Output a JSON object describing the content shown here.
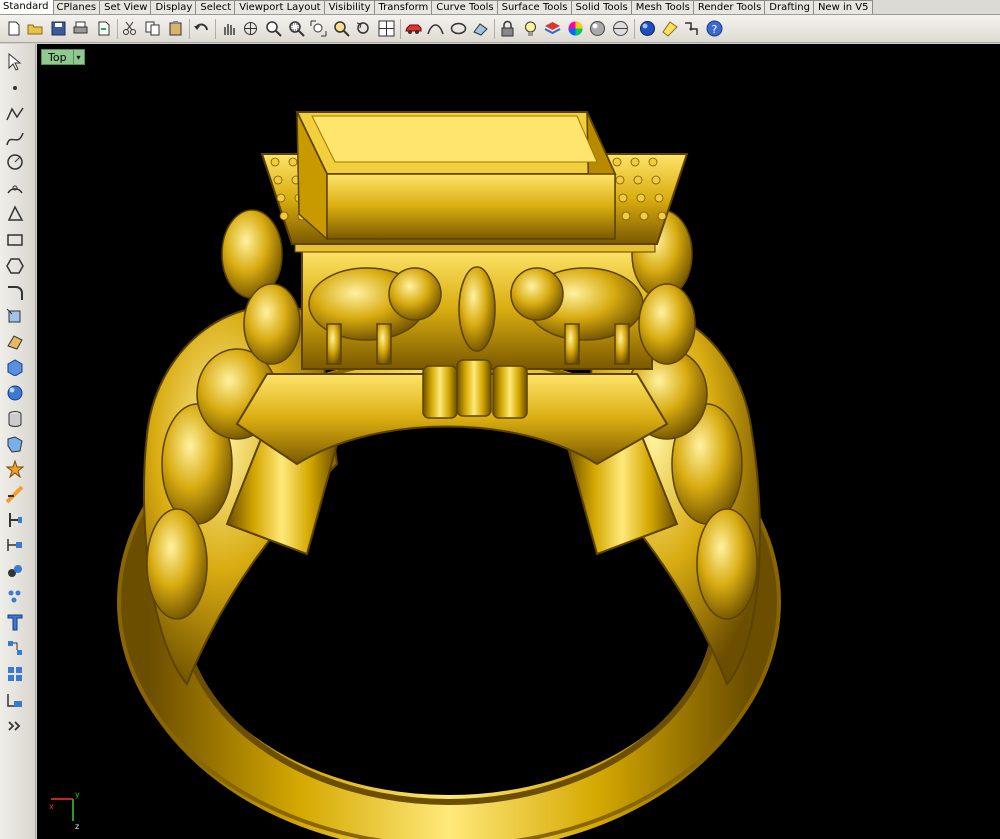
{
  "tabs": [
    "Standard",
    "CPlanes",
    "Set View",
    "Display",
    "Select",
    "Viewport Layout",
    "Visibility",
    "Transform",
    "Curve Tools",
    "Surface Tools",
    "Solid Tools",
    "Mesh Tools",
    "Render Tools",
    "Drafting",
    "New in V5"
  ],
  "active_tab": "Standard",
  "toolbar_icons": [
    "new-document-icon",
    "open-folder-icon",
    "save-icon",
    "print-icon",
    "import-icon",
    "cut-icon",
    "copy-icon",
    "paste-icon",
    "undo-icon",
    "pan-hand-icon",
    "rotate-view-icon",
    "zoom-icon",
    "zoom-window-icon",
    "zoom-extents-icon",
    "zoom-selected-icon",
    "undo-view-icon",
    "four-viewports-icon",
    "car-object-icon",
    "curve-tools-icon",
    "ellipse-tools-icon",
    "surface-icon",
    "lock-icon",
    "lightbulb-icon",
    "layers-icon",
    "color-wheel-icon",
    "sphere-shade-icon",
    "sphere-render-icon",
    "sphere-blue-icon",
    "spotlight-icon",
    "snap-grid-icon",
    "help-icon"
  ],
  "left_icons": [
    "select-arrow-icon",
    "point-icon",
    "polyline-icon",
    "curve-icon",
    "circle-icon",
    "arc-icon",
    "polygon-icon",
    "rectangle-icon",
    "hexagon-icon",
    "fillet-icon",
    "transform-icon",
    "surface-patch-icon",
    "box-solid-icon",
    "sphere-solid-icon",
    "cylinder-icon",
    "mesh-icon",
    "explode-icon",
    "boolean-icon",
    "split-icon",
    "dimension-icon",
    "group-icon",
    "cluster-icon",
    "text-icon",
    "array-icon",
    "block-icon",
    "gumball-icon",
    "expand-icon"
  ],
  "viewport": {
    "label": "Top",
    "menu_glyph": "▾"
  },
  "axes": {
    "x": "x",
    "y": "y",
    "z": "z"
  },
  "colors": {
    "gold": "#d4a800",
    "gold_light": "#ffe97a",
    "gold_dark": "#6b4e00",
    "viewport_bg": "#000000",
    "viewport_tag": "#8fc98f"
  }
}
